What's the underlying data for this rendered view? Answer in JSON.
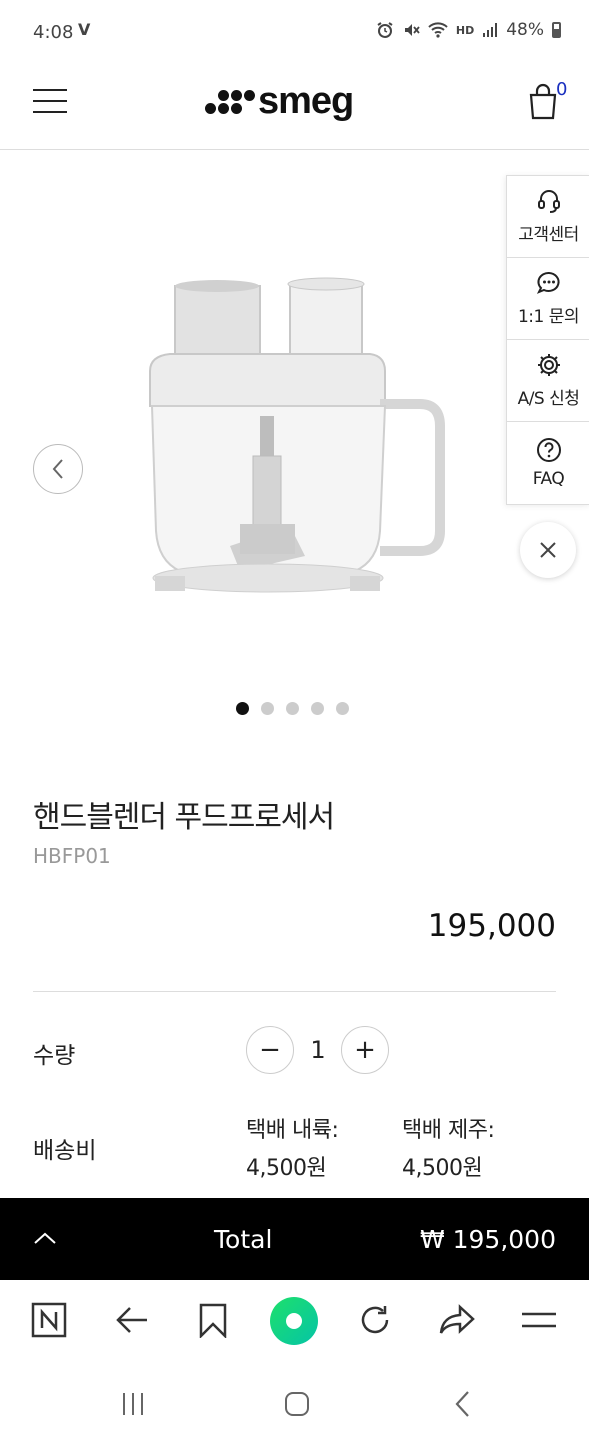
{
  "status_bar": {
    "time": "4:08",
    "left_icon": "V",
    "right_icons": [
      "alarm-icon",
      "mute-icon",
      "wifi-icon",
      "hd-voice-icon",
      "signal-icon"
    ],
    "hd_text": "HD",
    "battery": "48%"
  },
  "header": {
    "logo": "smeg",
    "cart_count": "0"
  },
  "side_menu": {
    "items": [
      {
        "label": "고객센터",
        "icon": "headset-icon"
      },
      {
        "label": "1:1 문의",
        "icon": "chat-icon"
      },
      {
        "label": "A/S 신청",
        "icon": "gear-icon"
      },
      {
        "label": "FAQ",
        "icon": "question-icon"
      }
    ]
  },
  "carousel": {
    "total_slides": 5,
    "active_index": 0
  },
  "product": {
    "name": "핸드블렌더 푸드프로세서",
    "code": "HBFP01",
    "price": "195,000"
  },
  "quantity": {
    "label": "수량",
    "minus": "−",
    "value": "1",
    "plus": "+"
  },
  "shipping": {
    "label": "배송비",
    "options": [
      {
        "name": "택배 내륙:",
        "price": "4,500원"
      },
      {
        "name": "택배 제주:",
        "price": "4,500원"
      }
    ]
  },
  "total": {
    "label": "Total",
    "value": "₩ 195,000"
  },
  "colors": {
    "total_bar": "#000000",
    "cart_badge": "#1a2fbf",
    "home_button": "#14d88a"
  }
}
